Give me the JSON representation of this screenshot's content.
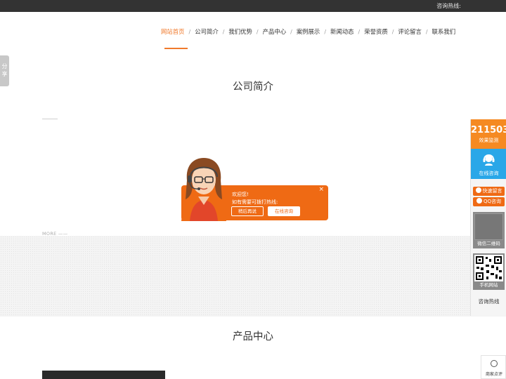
{
  "topbar": {
    "hotline_label": "咨询热线:"
  },
  "nav": {
    "items": [
      {
        "label": "网站首页"
      },
      {
        "label": "公司简介"
      },
      {
        "label": "我们优势"
      },
      {
        "label": "产品中心"
      },
      {
        "label": "案例展示"
      },
      {
        "label": "新闻动态"
      },
      {
        "label": "荣誉资质"
      },
      {
        "label": "评论留言"
      },
      {
        "label": "联系我们"
      }
    ],
    "separator": "/",
    "accent_color": "#f07a2c"
  },
  "share": {
    "label_1": "分",
    "label_2": "享"
  },
  "about": {
    "title": "公司简介",
    "more": "MORE ——"
  },
  "products": {
    "title": "产品中心"
  },
  "chat_popup": {
    "close": "×",
    "greeting": "欢迎您!",
    "message": "如有需要可拨打热线:",
    "later_button": "稍后再说",
    "online_button": "在线咨询",
    "color": "#ef6a14"
  },
  "right_panel": {
    "count_value": "211503",
    "count_label": "效果监测",
    "online_label": "在线咨询",
    "message_button": "快速留言",
    "qq_button": "QQ咨询",
    "wechat_caption": "微信二维码",
    "mobile_caption": "手机网站",
    "hotline_label": "咨询热线"
  },
  "review_button": {
    "label": "商家点评"
  }
}
